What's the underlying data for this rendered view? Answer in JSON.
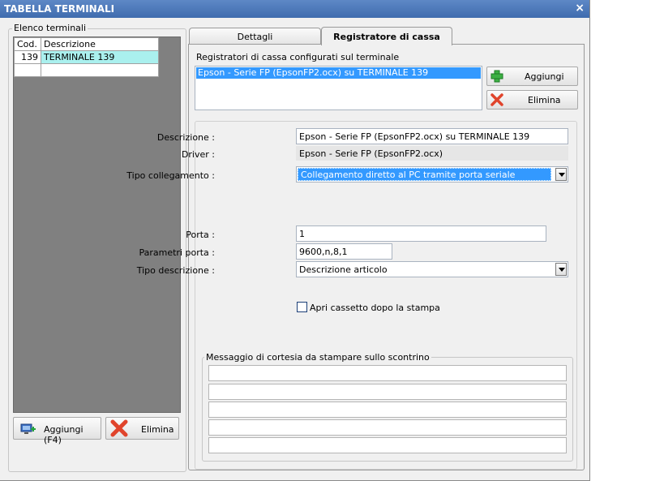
{
  "window": {
    "title": "TABELLA TERMINALI",
    "close": "×"
  },
  "left": {
    "legend": "Elenco terminali",
    "columns": [
      "Cod.",
      "Descrizione"
    ],
    "rows": [
      {
        "cod": "139",
        "descr": "TERMINALE 139"
      }
    ],
    "add_label": "Aggiungi (F4)",
    "delete_label": "Elimina"
  },
  "tabs": [
    {
      "label": "Dettagli"
    },
    {
      "label": "Registratore di cassa"
    }
  ],
  "registers": {
    "caption": "Registratori di cassa configurati sul terminale",
    "items": [
      "Epson - Serie FP (EpsonFP2.ocx) su TERMINALE 139"
    ],
    "add_label": "Aggiungi",
    "delete_label": "Elimina"
  },
  "form": {
    "descrizione_label": "Descrizione :",
    "descrizione_value": "Epson - Serie FP (EpsonFP2.ocx) su TERMINALE 139",
    "driver_label": "Driver :",
    "driver_value": "Epson - Serie FP (EpsonFP2.ocx)",
    "tipo_coll_label": "Tipo collegamento :",
    "tipo_coll_value": "Collegamento diretto al PC tramite porta seriale",
    "porta_label": "Porta :",
    "porta_value": "1",
    "param_label": "Parametri porta :",
    "param_value": "9600,n,8,1",
    "tipo_descr_label": "Tipo descrizione :",
    "tipo_descr_value": "Descrizione articolo",
    "cassetto_label": "Apri cassetto dopo la stampa",
    "messaggio_legend": "Messaggio di cortesia da stampare sullo scontrino"
  },
  "colors": {
    "title_bar": "#4a78b8",
    "selection": "#3399ff",
    "grid_selection": "#aaf0ee"
  }
}
